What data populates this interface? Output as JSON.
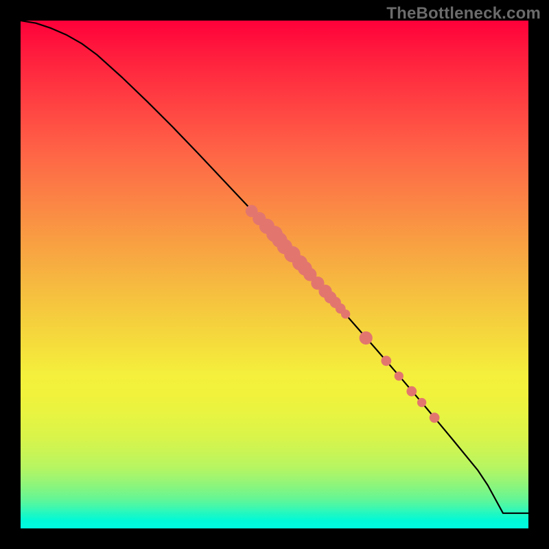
{
  "watermark": "TheBottleneck.com",
  "chart_data": {
    "type": "line",
    "title": "",
    "xlabel": "",
    "ylabel": "",
    "xlim": [
      0,
      100
    ],
    "ylim": [
      0,
      100
    ],
    "grid": false,
    "series": [
      {
        "name": "curve",
        "x": [
          0,
          3,
          6,
          9,
          12,
          15,
          20,
          25,
          30,
          35,
          40,
          45,
          50,
          55,
          60,
          65,
          70,
          75,
          80,
          85,
          90,
          92,
          95,
          100
        ],
        "y": [
          100,
          99.5,
          98.5,
          97.2,
          95.5,
          93.3,
          88.8,
          84.0,
          79.0,
          73.8,
          68.5,
          63.2,
          57.8,
          52.3,
          46.7,
          41.0,
          35.3,
          29.5,
          23.6,
          17.6,
          11.5,
          8.5,
          3.0,
          3.0
        ]
      }
    ],
    "points": [
      {
        "x": 45.5,
        "y": 62.5,
        "r": 1.2
      },
      {
        "x": 47.0,
        "y": 61.0,
        "r": 1.3
      },
      {
        "x": 48.5,
        "y": 59.5,
        "r": 1.5
      },
      {
        "x": 50.0,
        "y": 58.0,
        "r": 1.6
      },
      {
        "x": 51.0,
        "y": 56.8,
        "r": 1.5
      },
      {
        "x": 52.0,
        "y": 55.5,
        "r": 1.5
      },
      {
        "x": 53.5,
        "y": 54.0,
        "r": 1.6
      },
      {
        "x": 55.0,
        "y": 52.3,
        "r": 1.5
      },
      {
        "x": 56.0,
        "y": 51.2,
        "r": 1.4
      },
      {
        "x": 57.0,
        "y": 50.0,
        "r": 1.3
      },
      {
        "x": 58.5,
        "y": 48.3,
        "r": 1.3
      },
      {
        "x": 60.0,
        "y": 46.7,
        "r": 1.3
      },
      {
        "x": 61.0,
        "y": 45.5,
        "r": 1.2
      },
      {
        "x": 62.0,
        "y": 44.5,
        "r": 1.1
      },
      {
        "x": 63.0,
        "y": 43.3,
        "r": 1.0
      },
      {
        "x": 64.0,
        "y": 42.2,
        "r": 0.9
      },
      {
        "x": 68.0,
        "y": 37.5,
        "r": 1.3
      },
      {
        "x": 72.0,
        "y": 33.0,
        "r": 1.0
      },
      {
        "x": 74.5,
        "y": 30.0,
        "r": 0.9
      },
      {
        "x": 77.0,
        "y": 27.0,
        "r": 1.0
      },
      {
        "x": 79.0,
        "y": 24.8,
        "r": 0.9
      },
      {
        "x": 81.5,
        "y": 21.8,
        "r": 1.0
      }
    ]
  }
}
